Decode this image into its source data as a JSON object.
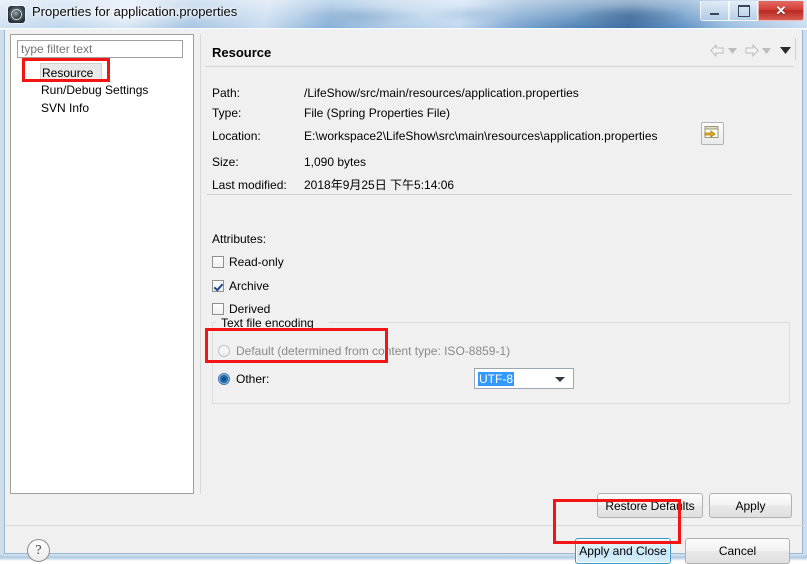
{
  "window": {
    "title": "Properties for application.properties",
    "icon": "gear-icon",
    "minimize_label": "",
    "maximize_label": "",
    "close_label": "✕"
  },
  "sidebar": {
    "filter_placeholder": "type filter text",
    "filter_value": "",
    "items": [
      {
        "label": "Resource",
        "selected": true
      },
      {
        "label": "Run/Debug Settings",
        "selected": false
      },
      {
        "label": "SVN Info",
        "selected": false
      }
    ]
  },
  "page": {
    "title": "Resource",
    "nav": {
      "back_icon": "back-arrow-icon",
      "back_dropdown_icon": "chevron-down-icon",
      "forward_icon": "forward-arrow-icon",
      "forward_dropdown_icon": "chevron-down-icon",
      "menu_icon": "chevron-down-icon"
    },
    "fields": [
      {
        "label": "Path:",
        "value": "/LifeShow/src/main/resources/application.properties"
      },
      {
        "label": "Type:",
        "value": "File  (Spring Properties File)"
      },
      {
        "label": "Location:",
        "value": "E:\\workspace2\\LifeShow\\src\\main\\resources\\application.properties"
      },
      {
        "label": "Size:",
        "value": "1,090  bytes"
      },
      {
        "label": "Last modified:",
        "value": "2018年9月25日 下午5:14:06"
      }
    ],
    "location_button_icon": "open-external-folder-icon",
    "attributes_label": "Attributes:",
    "attributes": [
      {
        "label": "Read-only",
        "checked": false
      },
      {
        "label": "Archive",
        "checked": true
      },
      {
        "label": "Derived",
        "checked": false
      }
    ],
    "encoding_group": {
      "title": "Text file encoding",
      "default_option": {
        "label": "Default (determined from content type: ISO-8859-1)",
        "selected": false,
        "enabled": false
      },
      "other_option": {
        "label": "Other:",
        "selected": true,
        "value": "UTF-8",
        "dropdown_icon": "chevron-down-icon"
      }
    },
    "restore_defaults_label": "Restore Defaults",
    "apply_label": "Apply"
  },
  "footer": {
    "help_icon": "question-mark-icon",
    "help_glyph": "?",
    "apply_and_close_label": "Apply and Close",
    "cancel_label": "Cancel"
  },
  "annotations": {
    "color": "#f41414",
    "boxes": [
      "resource-tree-item",
      "other-encoding-row",
      "apply-and-close-button"
    ]
  }
}
